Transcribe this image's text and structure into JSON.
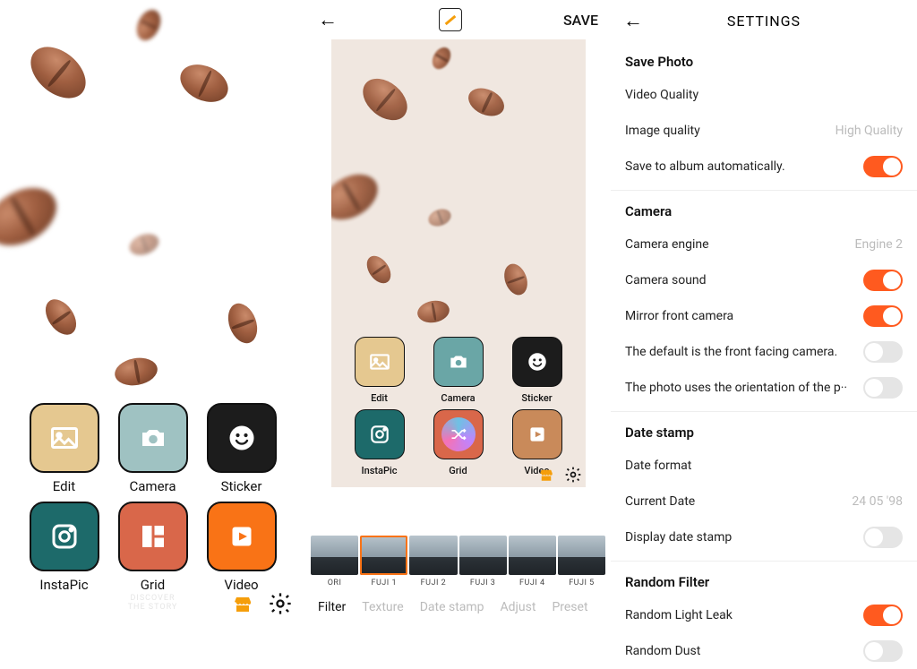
{
  "tiles": {
    "edit": "Edit",
    "camera": "Camera",
    "sticker": "Sticker",
    "instapic": "InstaPic",
    "grid": "Grid",
    "video": "Video"
  },
  "tile_colors": {
    "edit": "#e5c890",
    "camera": "#6aa6a6",
    "sticker": "#1c1c1c",
    "instapic": "#1d6a6a",
    "grid": "#d9674a",
    "video": "#f97316"
  },
  "panel2": {
    "save": "SAVE",
    "filters": [
      "ORI",
      "FUJI 1",
      "FUJI 2",
      "FUJI 3",
      "FUJI 4",
      "FUJI 5"
    ],
    "selected_filter_index": 1,
    "tabs": [
      "Filter",
      "Texture",
      "Date stamp",
      "Adjust",
      "Preset"
    ],
    "active_tab_index": 0
  },
  "settings": {
    "title": "SETTINGS",
    "sections": {
      "save_photo": {
        "header": "Save Photo",
        "video_quality": "Video Quality",
        "image_quality_label": "Image quality",
        "image_quality_value": "High Quality",
        "auto_save_label": "Save to album automatically.",
        "auto_save_on": true
      },
      "camera": {
        "header": "Camera",
        "engine_label": "Camera engine",
        "engine_value": "Engine 2",
        "sound_label": "Camera sound",
        "sound_on": true,
        "mirror_label": "Mirror front camera",
        "mirror_on": true,
        "default_front_label": "The default is the front facing camera.",
        "default_front_on": false,
        "orientation_label": "The photo uses the orientation of the p··",
        "orientation_on": false
      },
      "date_stamp": {
        "header": "Date stamp",
        "format_label": "Date format",
        "current_label": "Current Date",
        "current_value": "24 05 '98",
        "display_label": "Display date stamp",
        "display_on": false
      },
      "random_filter": {
        "header": "Random Filter",
        "leak_label": "Random Light Leak",
        "leak_on": true,
        "dust_label": "Random Dust",
        "dust_on": false
      }
    }
  }
}
